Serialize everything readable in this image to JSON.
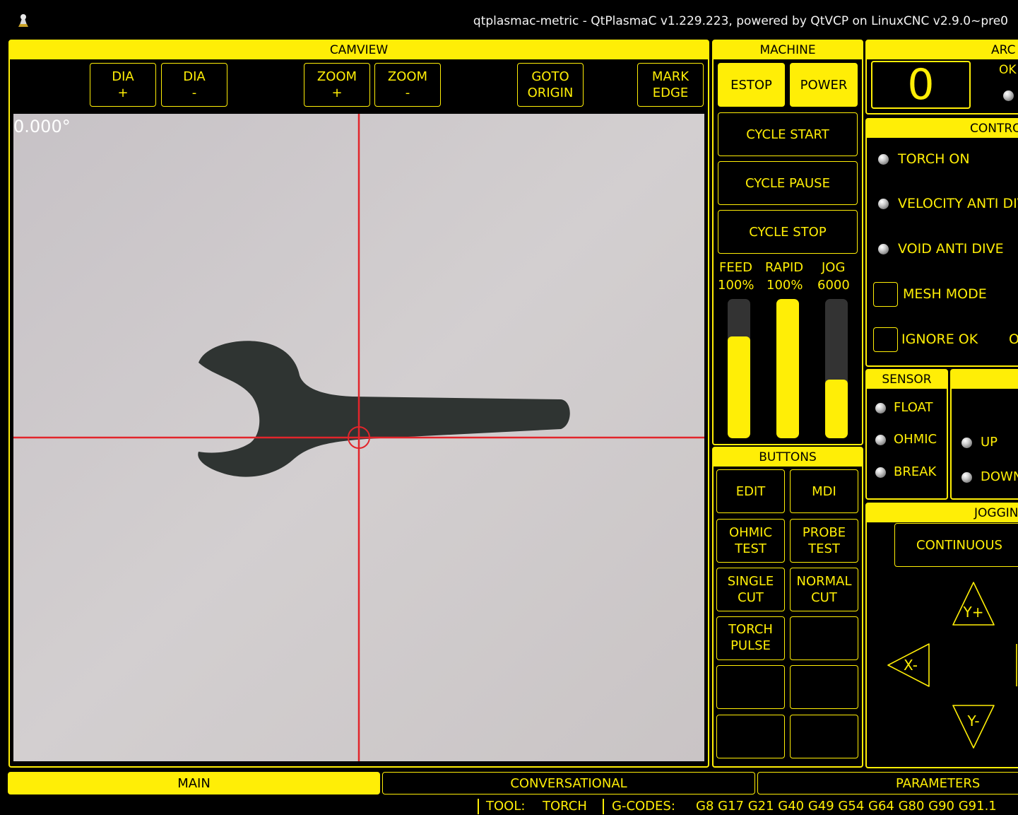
{
  "window": {
    "title": "qtplasmac-metric - QtPlasmaC v1.229.223, powered by QtVCP on LinuxCNC v2.9.0~pre0"
  },
  "camview": {
    "header": "CAMVIEW",
    "buttons": {
      "dia_plus": "DIA\n+",
      "dia_minus": "DIA\n-",
      "zoom_plus": "ZOOM\n+",
      "zoom_minus": "ZOOM\n-",
      "goto_origin": "GOTO\nORIGIN",
      "mark_edge": "MARK\nEDGE"
    },
    "angle": "0.000°",
    "colors": {
      "crosshair": "#e2252b",
      "background": "#cfcacc",
      "part": "#2f3432"
    }
  },
  "machine": {
    "header": "MACHINE",
    "estop": "ESTOP",
    "power": "POWER",
    "cycle_start": "CYCLE START",
    "cycle_pause": "CYCLE PAUSE",
    "cycle_stop": "CYCLE STOP",
    "overrides": {
      "feed_label": "FEED",
      "feed_value": "100%",
      "rapid_label": "RAPID",
      "rapid_value": "100%",
      "jog_label": "JOG",
      "jog_value": "6000",
      "feed_level": 0.73,
      "rapid_level": 1.0,
      "jog_level": 0.42
    }
  },
  "buttons_panel": {
    "header": "BUTTONS",
    "edit": "EDIT",
    "mdi": "MDI",
    "ohmic_test": "OHMIC\nTEST",
    "probe_test": "PROBE\nTEST",
    "single_cut": "SINGLE\nCUT",
    "normal_cut": "NORMAL\nCUT",
    "torch_pulse": "TORCH\nPULSE"
  },
  "arc": {
    "header": "ARC",
    "value": "0",
    "ok_label": "OK"
  },
  "control": {
    "header": "CONTROL",
    "torch_on": "TORCH ON",
    "velocity_anti_dive": "VELOCITY ANTI DIVE",
    "void_anti_dive": "VOID ANTI DIVE",
    "mesh_mode": "MESH MODE",
    "ignore_ok": "IGNORE OK",
    "extra": "O"
  },
  "sensor": {
    "header": "SENSOR",
    "float": "FLOAT",
    "ohmic": "OHMIC",
    "break": "BREAK"
  },
  "thc": {
    "up": "UP",
    "down": "DOWN"
  },
  "jogging": {
    "header": "JOGGING",
    "mode": "CONTINUOUS",
    "y_plus": "Y+",
    "y_minus": "Y-",
    "x_minus": "X-"
  },
  "tabs": {
    "main": "MAIN",
    "conversational": "CONVERSATIONAL",
    "parameters": "PARAMETERS"
  },
  "status": {
    "tool_label": "TOOL:",
    "tool_value": "TORCH",
    "gcodes_label": "G-CODES:",
    "gcodes_value": "G8 G17 G21 G40 G49 G54 G64 G80 G90 G91.1"
  }
}
